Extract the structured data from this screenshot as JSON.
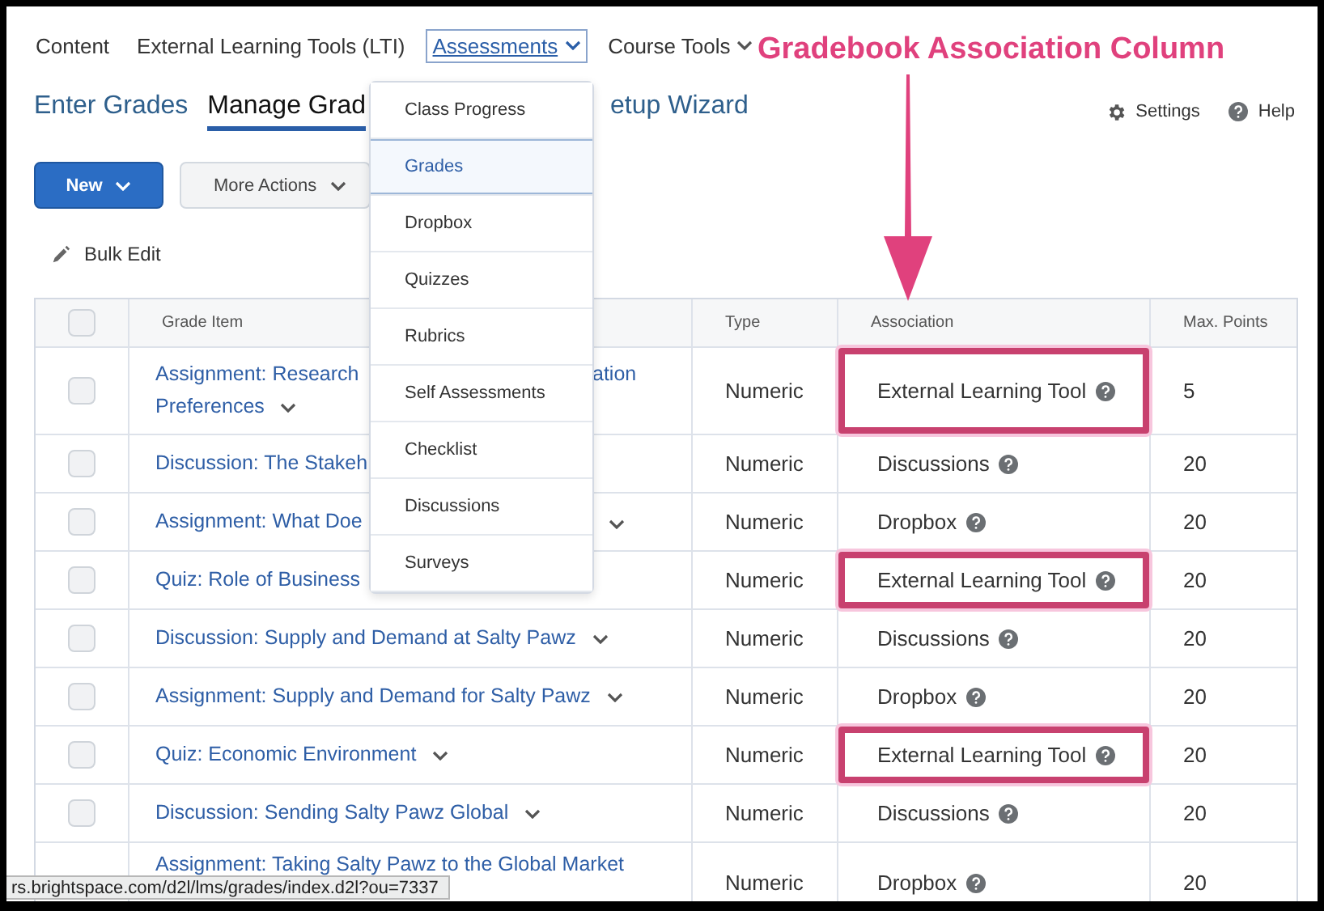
{
  "nav": {
    "items": [
      {
        "label": "Content",
        "selected": false,
        "dropdown": false
      },
      {
        "label": "External Learning Tools (LTI)",
        "selected": false,
        "dropdown": false
      },
      {
        "label": "Assessments",
        "selected": true,
        "dropdown": true
      },
      {
        "label": "Course Tools",
        "selected": false,
        "dropdown": true
      }
    ]
  },
  "tabs": [
    {
      "label": "Enter Grades",
      "selected": false
    },
    {
      "label": "Manage Grad",
      "selected": true
    },
    {
      "label": "etup Wizard",
      "selected": false
    }
  ],
  "page_actions": [
    {
      "kind": "settings",
      "label": "Settings"
    },
    {
      "kind": "help",
      "label": "Help"
    }
  ],
  "toolbar": {
    "new_button": "New",
    "more_button": "More Actions"
  },
  "bulk_edit": "Bulk Edit",
  "table": {
    "header_checked": false,
    "columns": [
      "Grade Item",
      "Type",
      "Association",
      "Max. Points"
    ],
    "rows": [
      {
        "kind": "wrapped",
        "checked": false,
        "title": "Assignment: Research",
        "title_tail": "ation",
        "title_line2": "Preferences",
        "chevron": true,
        "type": "Numeric",
        "association": "External Learning Tool",
        "highlighted": true,
        "points": "5"
      },
      {
        "kind": "covered",
        "checked": false,
        "title": "Discussion: The Stakeh",
        "chevron": false,
        "type": "Numeric",
        "association": "Discussions",
        "highlighted": false,
        "points": "20"
      },
      {
        "kind": "covered",
        "checked": false,
        "title": "Assignment: What Doe",
        "chevron": true,
        "type": "Numeric",
        "association": "Dropbox",
        "highlighted": false,
        "points": "20"
      },
      {
        "kind": "covered",
        "checked": false,
        "title": "Quiz: Role of Business",
        "chevron": false,
        "type": "Numeric",
        "association": "External Learning Tool",
        "highlighted": true,
        "points": "20"
      },
      {
        "kind": "plain",
        "checked": false,
        "title": "Discussion: Supply and Demand at Salty Pawz",
        "chevron": true,
        "type": "Numeric",
        "association": "Discussions",
        "highlighted": false,
        "points": "20"
      },
      {
        "kind": "plain",
        "checked": false,
        "title": "Assignment: Supply and Demand for Salty Pawz",
        "chevron": true,
        "type": "Numeric",
        "association": "Dropbox",
        "highlighted": false,
        "points": "20"
      },
      {
        "kind": "plain",
        "checked": false,
        "title": "Quiz: Economic Environment",
        "chevron": true,
        "type": "Numeric",
        "association": "External Learning Tool",
        "highlighted": true,
        "points": "20"
      },
      {
        "kind": "plain",
        "checked": false,
        "title": "Discussion: Sending Salty Pawz Global",
        "chevron": true,
        "type": "Numeric",
        "association": "Discussions",
        "highlighted": false,
        "points": "20"
      },
      {
        "kind": "plain",
        "title": "Assignment: Taking Salty Pawz to the Global Market",
        "chevron": false,
        "type": "Numeric",
        "association": "Dropbox",
        "highlighted": false,
        "points": "20"
      }
    ]
  },
  "assessments_menu": [
    {
      "label": "Class Progress",
      "selected": false
    },
    {
      "label": "Grades",
      "selected": true
    },
    {
      "label": "Dropbox",
      "selected": false
    },
    {
      "label": "Quizzes",
      "selected": false
    },
    {
      "label": "Rubrics",
      "selected": false
    },
    {
      "label": "Self Assessments",
      "selected": false
    },
    {
      "label": "Checklist",
      "selected": false
    },
    {
      "label": "Discussions",
      "selected": false
    },
    {
      "label": "Surveys",
      "selected": false
    }
  ],
  "annotation": {
    "title": "Gradebook Association Column"
  },
  "status_bar": {
    "url": "rs.brightspace.com/d2l/lms/grades/index.d2l?ou=7337"
  }
}
